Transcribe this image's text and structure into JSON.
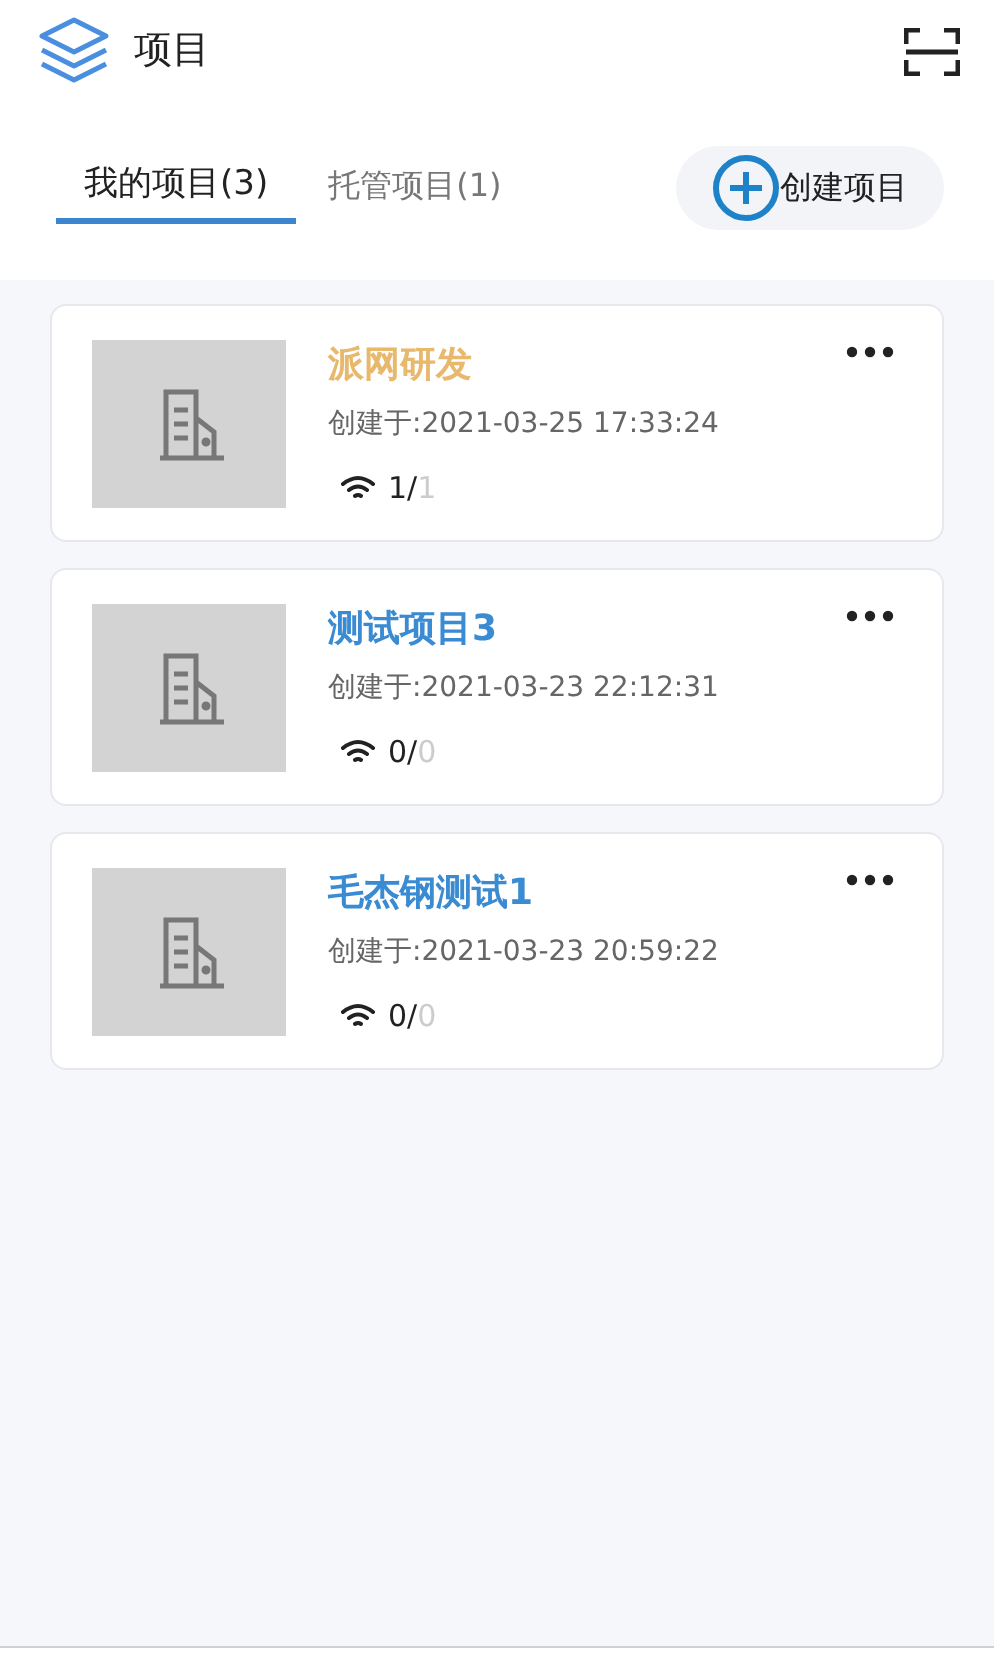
{
  "header": {
    "title": "项目"
  },
  "tabs": [
    {
      "label": "我的项目(3)",
      "selected": true
    },
    {
      "label": "托管项目(1)",
      "selected": false
    }
  ],
  "create_button": "创建项目",
  "projects": [
    {
      "name": "派网研发",
      "color": "#e8b86c",
      "created": "创建于:2021-03-25 17:33:24",
      "online": "1/",
      "total": "1"
    },
    {
      "name": "测试项目3",
      "color": "#3a8bd2",
      "created": "创建于:2021-03-23 22:12:31",
      "online": "0/",
      "total": "0"
    },
    {
      "name": "毛杰钢测试1",
      "color": "#3a8bd2",
      "created": "创建于:2021-03-23 20:59:22",
      "online": "0/",
      "total": "0"
    }
  ]
}
